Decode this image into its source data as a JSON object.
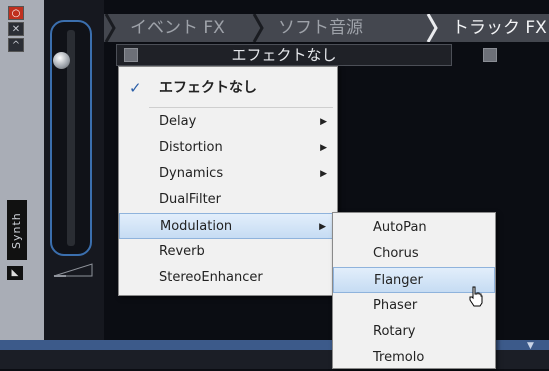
{
  "strip": {
    "buttons": [
      "○",
      "✕",
      "^"
    ],
    "label": "Synth",
    "foot": "◣"
  },
  "tabs": [
    {
      "label": "イベント FX"
    },
    {
      "label": "ソフト音源"
    },
    {
      "label": "トラック FX"
    }
  ],
  "fx_bar": {
    "label": "エフェクトなし"
  },
  "menu": {
    "checked_item": "エフェクトなし",
    "check_mark": "✓",
    "submenu_arrow": "▶",
    "items": [
      "Delay",
      "Distortion",
      "Dynamics",
      "DualFilter",
      "Modulation",
      "Reverb",
      "StereoEnhancer"
    ]
  },
  "submenu": {
    "items": [
      "AutoPan",
      "Chorus",
      "Flanger",
      "Phaser",
      "Rotary",
      "Tremolo"
    ]
  },
  "bottom": {
    "arrow": "▼"
  },
  "colors": {
    "accent": "#3b6fae",
    "highlight": "#c6dcf3",
    "tab_bg": "#44474f"
  }
}
